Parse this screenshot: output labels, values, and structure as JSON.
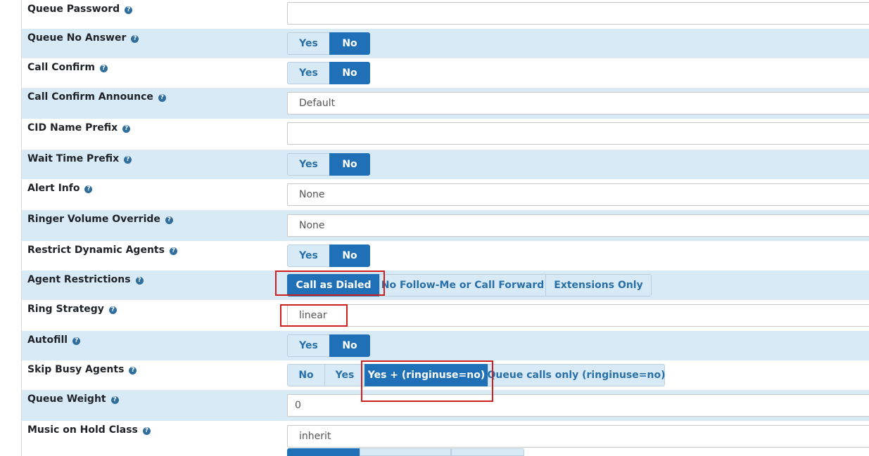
{
  "rows": [
    {
      "label": "Queue Password",
      "type": "input",
      "value": ""
    },
    {
      "label": "Queue No Answer",
      "type": "toggle",
      "options": [
        "Yes",
        "No"
      ],
      "selected": "No"
    },
    {
      "label": "Call Confirm",
      "type": "toggle",
      "options": [
        "Yes",
        "No"
      ],
      "selected": "No"
    },
    {
      "label": "Call Confirm Announce",
      "type": "select",
      "value": "Default"
    },
    {
      "label": "CID Name Prefix",
      "type": "input",
      "value": ""
    },
    {
      "label": "Wait Time Prefix",
      "type": "toggle",
      "options": [
        "Yes",
        "No"
      ],
      "selected": "No"
    },
    {
      "label": "Alert Info",
      "type": "select",
      "value": "None"
    },
    {
      "label": "Ringer Volume Override",
      "type": "select",
      "value": "None"
    },
    {
      "label": "Restrict Dynamic Agents",
      "type": "toggle",
      "options": [
        "Yes",
        "No"
      ],
      "selected": "No"
    },
    {
      "label": "Agent Restrictions",
      "type": "toggle",
      "options": [
        "Call as Dialed",
        "No Follow-Me or Call Forward",
        "Extensions Only"
      ],
      "selected": "Call as Dialed"
    },
    {
      "label": "Ring Strategy",
      "type": "select",
      "value": "linear"
    },
    {
      "label": "Autofill",
      "type": "toggle",
      "options": [
        "Yes",
        "No"
      ],
      "selected": "No"
    },
    {
      "label": "Skip Busy Agents",
      "type": "toggle",
      "options": [
        "No",
        "Yes",
        "Yes + (ringinuse=no)",
        "Queue calls only (ringinuse=no)"
      ],
      "selected": "Yes + (ringinuse=no)"
    },
    {
      "label": "Queue Weight",
      "type": "input",
      "value": "0"
    },
    {
      "label": "Music on Hold Class",
      "type": "select",
      "value": "inherit"
    }
  ],
  "help_icon_glyph": "?",
  "colors": {
    "row_alt_bg": "#d9eaf7",
    "button_active_bg": "#1f70b6",
    "button_inactive_bg": "#d9eaf7",
    "highlight_box": "#d01f1f"
  }
}
